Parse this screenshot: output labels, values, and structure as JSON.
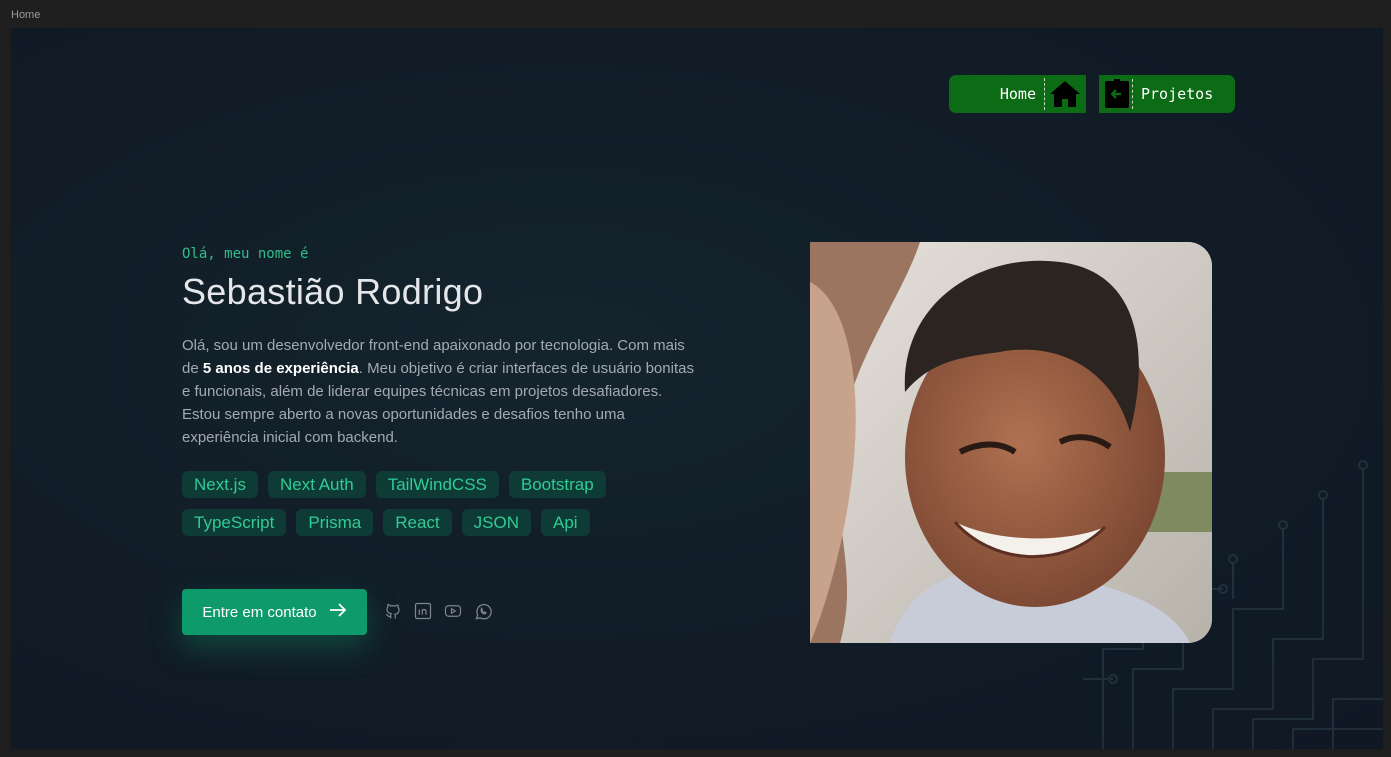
{
  "window": {
    "title": "Home"
  },
  "nav": {
    "home_label": "Home",
    "projects_label": "Projetos"
  },
  "hero": {
    "greeting": "Olá, meu nome é",
    "name": "Sebastião Rodrigo",
    "bio_before": "Olá, sou um desenvolvedor front-end apaixonado por tecnologia. Com mais de ",
    "bio_bold": "5 anos de experiência",
    "bio_after": ". Meu objetivo é criar interfaces de usuário bonitas e funcionais, além de liderar equipes técnicas em projetos desafiadores. Estou sempre aberto a novas oportunidades e desafios tenho uma experiência inicial com backend.",
    "tags": [
      "Next.js",
      "Next Auth",
      "TailWindCSS",
      "Bootstrap",
      "TypeScript",
      "Prisma",
      "React",
      "JSON",
      "Api"
    ],
    "cta_label": "Entre em contato"
  },
  "socials": [
    "github-icon",
    "linkedin-icon",
    "youtube-icon",
    "whatsapp-icon"
  ],
  "colors": {
    "accent": "#0e9a6a",
    "nav_green": "#0c6b15",
    "tag_bg": "#0f3b36",
    "tag_text": "#2fcc94",
    "background": "#111c27"
  }
}
